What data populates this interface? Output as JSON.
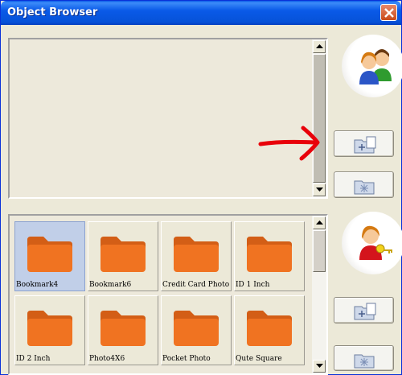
{
  "window": {
    "title": "Object Browser"
  },
  "icons": {
    "close": "close-icon",
    "users": "users-icon",
    "user_key": "user-key-icon",
    "add_folder": "add-folder-icon",
    "delete_folder": "delete-folder-icon",
    "folder": "folder-icon",
    "arrow": "red-arrow-icon"
  },
  "bottom_panel": {
    "items": [
      {
        "label": "Bookmark4",
        "selected": true
      },
      {
        "label": "Bookmark6",
        "selected": false
      },
      {
        "label": "Credit Card Photo",
        "selected": false
      },
      {
        "label": "ID 1 Inch",
        "selected": false
      },
      {
        "label": "ID 2 Inch",
        "selected": false
      },
      {
        "label": "Photo4X6",
        "selected": false
      },
      {
        "label": "Pocket Photo",
        "selected": false
      },
      {
        "label": "Qute Square",
        "selected": false
      }
    ]
  },
  "colors": {
    "folder": "#f07321",
    "folder_tab": "#d35e16",
    "selected_tile": "#c1cfe8",
    "arrow": "#e8000a",
    "title_bar": "#0a5ae8"
  }
}
